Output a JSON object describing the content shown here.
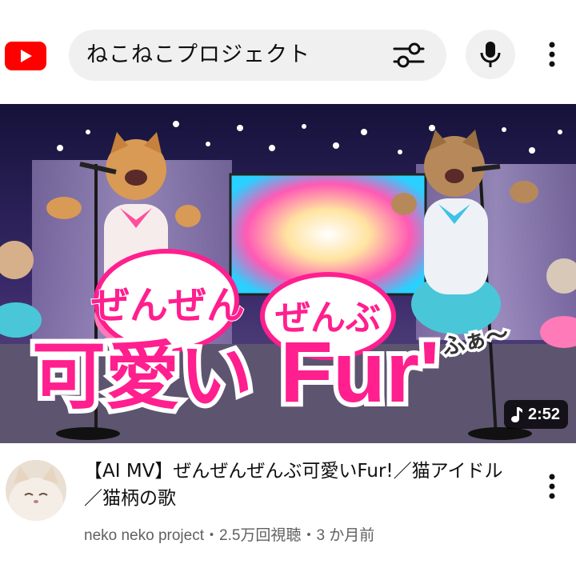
{
  "header": {
    "search_query": "ねこねこプロジェクト",
    "logo_icon": "youtube-logo-icon",
    "filter_icon": "search-filter-icon",
    "mic_icon": "microphone-icon",
    "menu_icon": "more-vertical-icon"
  },
  "video": {
    "thumbnail": {
      "overlay_line1": "ぜんぜん",
      "overlay_line2": "ぜんぶ",
      "overlay_main": "可愛い",
      "overlay_fur": "Fur'",
      "overlay_small": "ふぁ〜"
    },
    "duration": "2:52",
    "duration_icon": "music-note-icon",
    "title": "【AI MV】ぜんぜんぜんぶ可愛いFur!／猫アイドル／猫柄の歌",
    "channel": "neko neko project",
    "separator": "・",
    "views": "2.5万回視聴",
    "age": "3 か月前",
    "menu_icon": "more-vertical-icon"
  },
  "colors": {
    "brand_red": "#ff0000",
    "overlay_pink": "#ff1f8e",
    "meta_gray": "#606060"
  }
}
